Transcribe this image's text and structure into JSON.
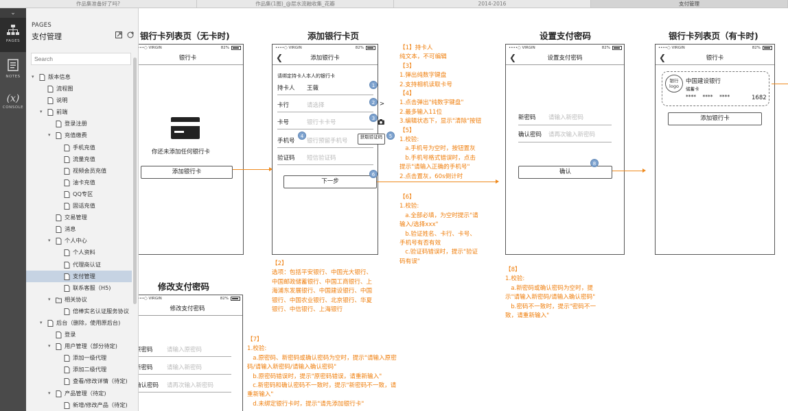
{
  "tabs": [
    "作品集准备好了吗?",
    "作品集(1图)_@层水流融收集_花瓣",
    "2014-2016",
    "支付管理"
  ],
  "rail": {
    "pages": "PAGES",
    "notes": "NOTES",
    "console": "CONSOLE",
    "console_glyph": "(x)"
  },
  "sidebar": {
    "section": "PAGES",
    "title": "支付管理",
    "search_placeholder": "Search",
    "tree": [
      {
        "label": "版本信息",
        "level": 0,
        "arrow": true
      },
      {
        "label": "流程图",
        "level": 1
      },
      {
        "label": "说明",
        "level": 1
      },
      {
        "label": "前端",
        "level": 1,
        "arrow": true
      },
      {
        "label": "登录注册",
        "level": 2
      },
      {
        "label": "充值缴费",
        "level": 2,
        "arrow": true
      },
      {
        "label": "手机充值",
        "level": 3
      },
      {
        "label": "流量充值",
        "level": 3
      },
      {
        "label": "视频会员充值",
        "level": 3
      },
      {
        "label": "油卡充值",
        "level": 3
      },
      {
        "label": "QQ专区",
        "level": 3
      },
      {
        "label": "固话充值",
        "level": 3
      },
      {
        "label": "交易管理",
        "level": 2
      },
      {
        "label": "消息",
        "level": 2
      },
      {
        "label": "个人中心",
        "level": 2,
        "arrow": true
      },
      {
        "label": "个人资料",
        "level": 3
      },
      {
        "label": "代理商认证",
        "level": 3
      },
      {
        "label": "支付管理",
        "level": 3,
        "selected": true
      },
      {
        "label": "联系客服（H5)",
        "level": 3
      },
      {
        "label": "相关协议",
        "level": 2,
        "arrow": true,
        "folder": true
      },
      {
        "label": "倍棒实名认证服务协议",
        "level": 3
      },
      {
        "label": "后台（删除，使用原后台)",
        "level": 1,
        "arrow": true
      },
      {
        "label": "登录",
        "level": 2
      },
      {
        "label": "用户管理（部分待定)",
        "level": 2,
        "arrow": true
      },
      {
        "label": "添加一级代理",
        "level": 3
      },
      {
        "label": "添加二级代理",
        "level": 3
      },
      {
        "label": "查看/修改详情（待定)",
        "level": 3
      },
      {
        "label": "产品管理（待定)",
        "level": 2,
        "arrow": true
      },
      {
        "label": "新增/修改产品（待定)",
        "level": 3
      }
    ]
  },
  "canvas": {
    "status_carrier": "••••○ VIRGIN",
    "status_pct": "82%",
    "s1": {
      "heading": "银行卡列表页（无卡时)",
      "nav": "银行卡",
      "empty": "你还未添加任何银行卡",
      "button": "添加银行卡"
    },
    "s2": {
      "heading": "添加银行卡页",
      "nav": "添加银行卡",
      "hint": "请绑定持卡人本人的银行卡",
      "holder_label": "持卡人",
      "holder_value": "王薇",
      "bank_label": "卡行",
      "bank_ph": "请选择",
      "chev": ">",
      "card_label": "卡号",
      "card_ph": "银行卡卡号",
      "phone_label": "手机号",
      "phone_ph": "银行预留手机号",
      "code_btn": "获取验证码",
      "code_label": "验证码",
      "code_ph": "短信验证码",
      "next": "下一步",
      "badges": [
        "1",
        "2",
        "3",
        "4",
        "5",
        "6"
      ]
    },
    "s3": {
      "heading": "设置支付密码",
      "nav": "设置支付密码",
      "new_label": "新密码",
      "new_ph": "请输入新密码",
      "confirm_label": "确认密码",
      "confirm_ph": "请再次输入新密码",
      "button": "确认",
      "badge": "8"
    },
    "s4": {
      "heading": "银行卡列表页（有卡时)",
      "nav": "银行卡",
      "logo": "银行\nlogo",
      "bank": "中国建设银行",
      "type": "储蓄卡",
      "mask": "****    ****    ****",
      "last4": "1682",
      "button": "添加银行卡"
    },
    "s5": {
      "heading": "修改支付密码",
      "nav": "修改支付密码",
      "old_label": "原密码",
      "old_ph": "请输入原密码",
      "new_label": "新密码",
      "new_ph": "请输入新密码",
      "confirm_label": "确认密码",
      "confirm_ph": "请再次输入新密码"
    },
    "notes": {
      "n1": "【1】持卡人\n纯文本，不可编辑\n【3】\n1.弹出纯数字键盘\n2.支持相机读取卡号\n【4】\n1.点击弹出\"纯数字键盘\"\n2.最多输入11位\n3.编辑状态下，显示\"清除\"按钮\n【5】\n1.校验:\n   a.手机号为空时，按钮置灰\n   b.手机号格式错误时，点击\n提示\"请输入正确的手机号\"\n2.点击置灰，60s倒计时",
      "n6": "【6】\n1.校验:\n   a.全部必填，为空时提示\"请\n输入/选择xxx\"\n   b.验证姓名、卡行、卡号、\n手机号有否有效\n   c.验证码错误时，提示\"验证\n码有误\"",
      "n2": "【2】\n选项：包括平安银行、中国光大银行、\n中国邮政储蓄银行、中国工商银行、上\n海浦东发展银行、中国建设银行、中国\n银行、中国农业银行、北京银行、华夏\n银行、中信银行、上海银行",
      "n8": "【8】\n1.校验:\n   a.新密码或确认密码为空时，提\n示\"请输入新密码/请输入确认密码\"\n   b.密码不一致时，提示\"密码不一\n致，请重新输入\"",
      "n7": "【7】\n1.校验:\n   a.原密码、新密码或确认密码为空时，提示\"请输入原密\n码/请输入新密码/请输入确认密码\"\n   b.原密码错误时，提示\"原密码错误，请重新输入\"\n   c.新密码和确认密码不一致时，提示\"新密码不一致，请\n重新输入\"\n   d.未绑定银行卡时，提示\"请先添加银行卡\""
    }
  }
}
